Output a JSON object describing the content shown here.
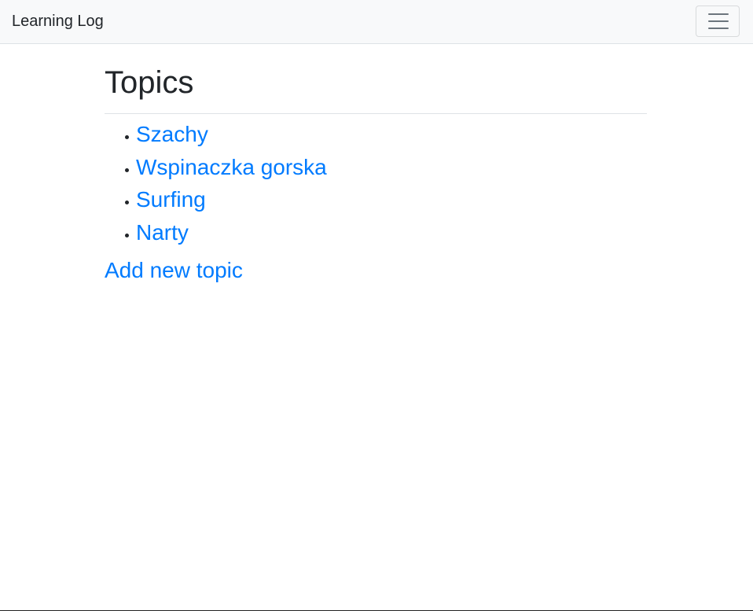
{
  "navbar": {
    "brand": "Learning Log",
    "toggler_icon": "hamburger-menu-icon"
  },
  "main": {
    "title": "Topics",
    "topics": [
      {
        "label": "Szachy"
      },
      {
        "label": "Wspinaczka gorska"
      },
      {
        "label": "Surfing"
      },
      {
        "label": "Narty"
      }
    ],
    "add_topic_label": "Add new topic"
  },
  "colors": {
    "link": "#007bff",
    "navbar_bg": "#f8f9fa",
    "text": "#212529"
  }
}
